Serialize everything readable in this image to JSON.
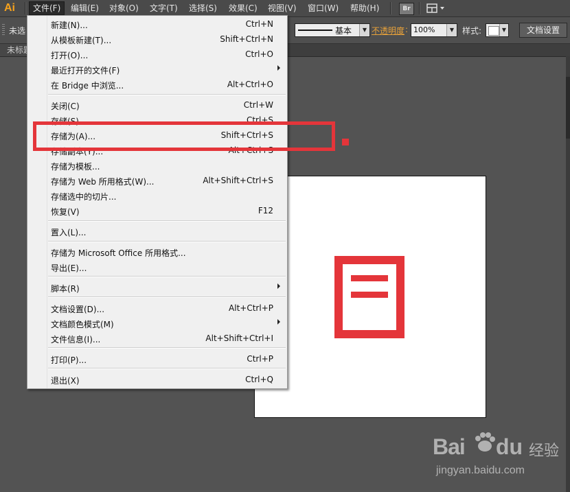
{
  "app": {
    "logo": "Ai"
  },
  "menubar": {
    "items": [
      "文件(F)",
      "编辑(E)",
      "对象(O)",
      "文字(T)",
      "选择(S)",
      "效果(C)",
      "视图(V)",
      "窗口(W)",
      "帮助(H)"
    ],
    "bridge_label": "Br"
  },
  "controlbar": {
    "selection_status": "未选",
    "stroke_profile": "基本",
    "opacity_label": "不透明度",
    "opacity_value": "100%",
    "style_label": "样式:",
    "doc_setup": "文档设置"
  },
  "tab": {
    "title": "未标题"
  },
  "file_menu": {
    "groups": [
      [
        {
          "label": "新建(N)...",
          "shortcut": "Ctrl+N"
        },
        {
          "label": "从模板新建(T)...",
          "shortcut": "Shift+Ctrl+N"
        },
        {
          "label": "打开(O)...",
          "shortcut": "Ctrl+O"
        },
        {
          "label": "最近打开的文件(F)",
          "shortcut": "",
          "submenu": true
        },
        {
          "label": "在 Bridge 中浏览...",
          "shortcut": "Alt+Ctrl+O"
        }
      ],
      [
        {
          "label": "关闭(C)",
          "shortcut": "Ctrl+W"
        },
        {
          "label": "存储(S)",
          "shortcut": "Ctrl+S"
        },
        {
          "label": "存储为(A)...",
          "shortcut": "Shift+Ctrl+S"
        },
        {
          "label": "存储副本(Y)...",
          "shortcut": "Alt+Ctrl+S"
        },
        {
          "label": "存储为模板...",
          "shortcut": ""
        },
        {
          "label": "存储为 Web 所用格式(W)...",
          "shortcut": "Alt+Shift+Ctrl+S"
        },
        {
          "label": "存储选中的切片...",
          "shortcut": ""
        },
        {
          "label": "恢复(V)",
          "shortcut": "F12"
        }
      ],
      [
        {
          "label": "置入(L)...",
          "shortcut": ""
        }
      ],
      [
        {
          "label": "存储为 Microsoft Office 所用格式...",
          "shortcut": ""
        },
        {
          "label": "导出(E)...",
          "shortcut": ""
        }
      ],
      [
        {
          "label": "脚本(R)",
          "shortcut": "",
          "submenu": true
        }
      ],
      [
        {
          "label": "文档设置(D)...",
          "shortcut": "Alt+Ctrl+P"
        },
        {
          "label": "文档颜色模式(M)",
          "shortcut": "",
          "submenu": true
        },
        {
          "label": "文件信息(I)...",
          "shortcut": "Alt+Shift+Ctrl+I"
        }
      ],
      [
        {
          "label": "打印(P)...",
          "shortcut": "Ctrl+P"
        }
      ],
      [
        {
          "label": "退出(X)",
          "shortcut": "Ctrl+Q"
        }
      ]
    ]
  },
  "colors": {
    "highlight": "#e4353a",
    "logo": "#f7a21c",
    "opacity_label": "#e8a23a"
  },
  "watermark": {
    "brand_left": "Bai",
    "brand_right": "经验",
    "brand_paw": "du",
    "url": "jingyan.baidu.com"
  }
}
